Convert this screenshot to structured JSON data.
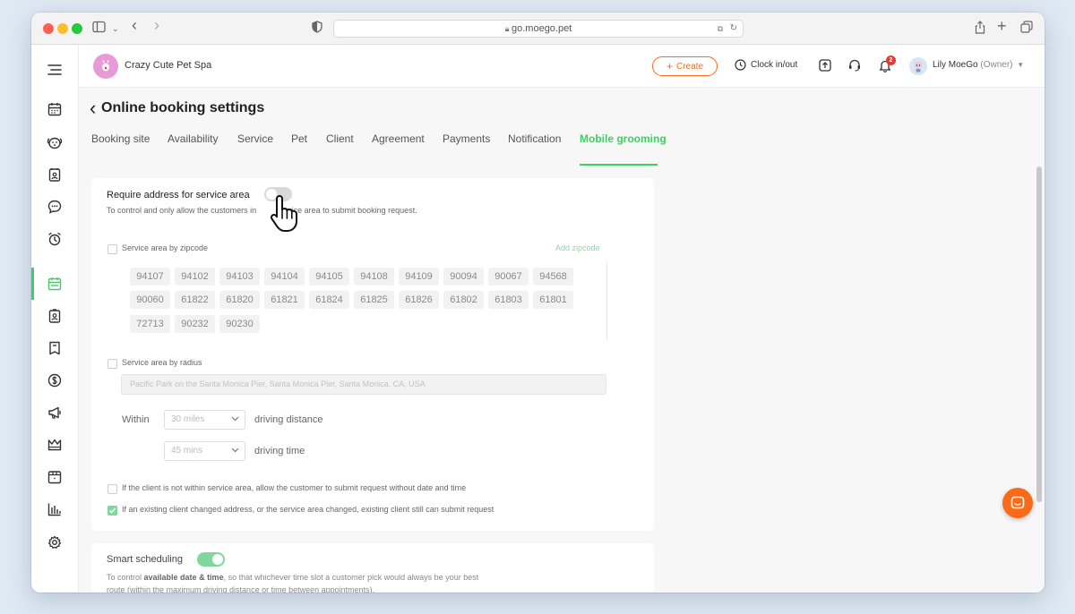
{
  "browser": {
    "url": "go.moego.pet"
  },
  "business": {
    "name": "Crazy Cute Pet Spa"
  },
  "header": {
    "create_label": "Create",
    "clock_label": "Clock in/out",
    "notification_count": "2",
    "user_name": "Lily MoeGo",
    "user_role": "(Owner)"
  },
  "page": {
    "title": "Online booking settings"
  },
  "tabs": [
    "Booking site",
    "Availability",
    "Service",
    "Pet",
    "Client",
    "Agreement",
    "Payments",
    "Notification",
    "Mobile grooming"
  ],
  "active_tab": "Mobile grooming",
  "service_area": {
    "title": "Require address for service area",
    "desc_before": "To control and only allow the customers in",
    "desc_after": "service area to submit booking request.",
    "zipcode_label": "Service area by zipcode",
    "add_zipcode": "Add zipcode",
    "zipcodes": [
      "94107",
      "94102",
      "94103",
      "94104",
      "94105",
      "94108",
      "94109",
      "90094",
      "90067",
      "94568",
      "90060",
      "61822",
      "61820",
      "61821",
      "61824",
      "61825",
      "61826",
      "61802",
      "61803",
      "61801",
      "72713",
      "90232",
      "90230"
    ],
    "radius_label": "Service area by radius",
    "address_placeholder": "Pacific Park on the Santa Monica Pier, Santa Monica Pier, Santa Monica, CA, USA",
    "within_label": "Within",
    "distance_value": "30 miles",
    "distance_label": "driving distance",
    "time_value": "45 mins",
    "time_label": "driving time",
    "option1": "If the client is not within service area, allow the customer to submit request without date and time",
    "option2": "If an existing client changed address, or the service area changed, existing client still can submit request",
    "toggle_on": false,
    "option1_checked": false,
    "option2_checked": true
  },
  "smart_scheduling": {
    "title": "Smart scheduling",
    "desc_pre": "To control ",
    "desc_bold": "available date & time",
    "desc_post": ", so that whichever time slot a customer pick would always be your best",
    "desc_line2": "route (within the maximum driving distance or time between appointments).",
    "toggle_on": true
  },
  "colors": {
    "brand": "#f96b18",
    "accent": "#3ecf62"
  }
}
